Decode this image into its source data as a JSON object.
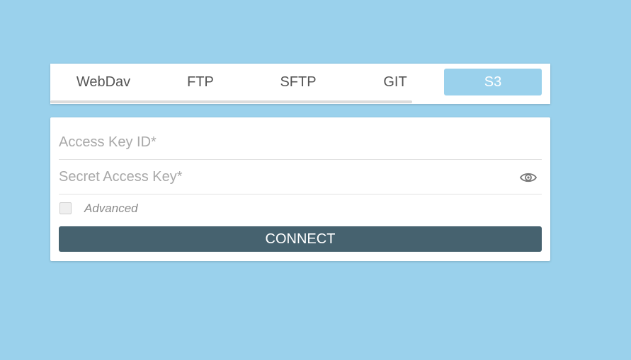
{
  "tabs": [
    {
      "label": "WebDav",
      "active": false
    },
    {
      "label": "FTP",
      "active": false
    },
    {
      "label": "SFTP",
      "active": false
    },
    {
      "label": "GIT",
      "active": false
    },
    {
      "label": "S3",
      "active": true
    }
  ],
  "form": {
    "access_key": {
      "placeholder": "Access Key ID*",
      "value": ""
    },
    "secret_key": {
      "placeholder": "Secret Access Key*",
      "value": "",
      "toggle_icon": "eye-icon"
    },
    "advanced": {
      "label": "Advanced",
      "checked": false
    },
    "connect_label": "CONNECT"
  },
  "colors": {
    "background": "#9ad1ec",
    "active_tab": "#9ad1ec",
    "button": "#46626f"
  }
}
